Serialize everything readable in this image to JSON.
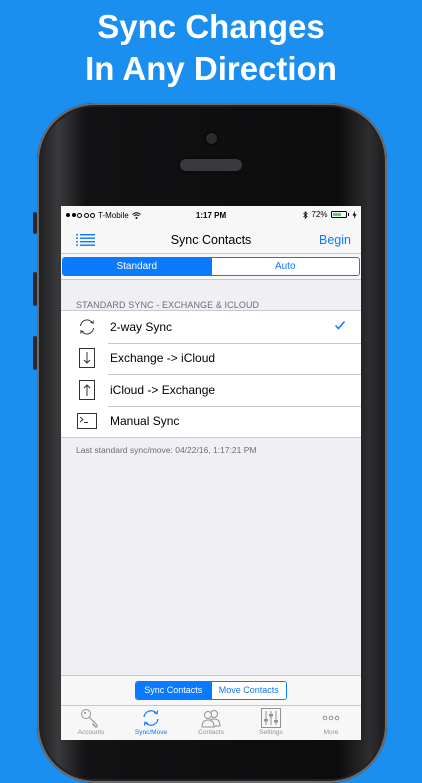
{
  "headline": {
    "line1": "Sync Changes",
    "line2": "In Any Direction"
  },
  "status_bar": {
    "carrier": "T-Mobile",
    "time": "1:17 PM",
    "battery": "72%"
  },
  "nav": {
    "title": "Sync Contacts",
    "right_button": "Begin",
    "menu_icon": "list-menu-icon"
  },
  "mode_segment": {
    "options": [
      "Standard",
      "Auto"
    ],
    "selected": "Standard"
  },
  "section": {
    "header": "STANDARD SYNC - EXCHANGE & ICLOUD",
    "rows": [
      {
        "label": "2-way Sync",
        "icon": "two-way-sync-icon",
        "checked": true
      },
      {
        "label": "Exchange -> iCloud",
        "icon": "down-arrow-icon",
        "checked": false
      },
      {
        "label": "iCloud -> Exchange",
        "icon": "up-arrow-icon",
        "checked": false
      },
      {
        "label": "Manual Sync",
        "icon": "terminal-icon",
        "checked": false
      }
    ],
    "footer": "Last standard sync/move: 04/22/16, 1:17:21 PM"
  },
  "bottom_segment": {
    "options": [
      "Sync Contacts",
      "Move Contacts"
    ],
    "selected": "Sync Contacts"
  },
  "tabs": [
    {
      "label": "Accounts",
      "icon": "key-icon",
      "active": false
    },
    {
      "label": "Sync/Move",
      "icon": "sync-icon",
      "active": true
    },
    {
      "label": "Contacts",
      "icon": "contacts-icon",
      "active": false
    },
    {
      "label": "Settings",
      "icon": "sliders-icon",
      "active": false
    },
    {
      "label": "More",
      "icon": "more-dots-icon",
      "active": false
    }
  ],
  "colors": {
    "background": "#1b8ff0",
    "accent": "#0a7aff",
    "battery": "#4cd964"
  }
}
